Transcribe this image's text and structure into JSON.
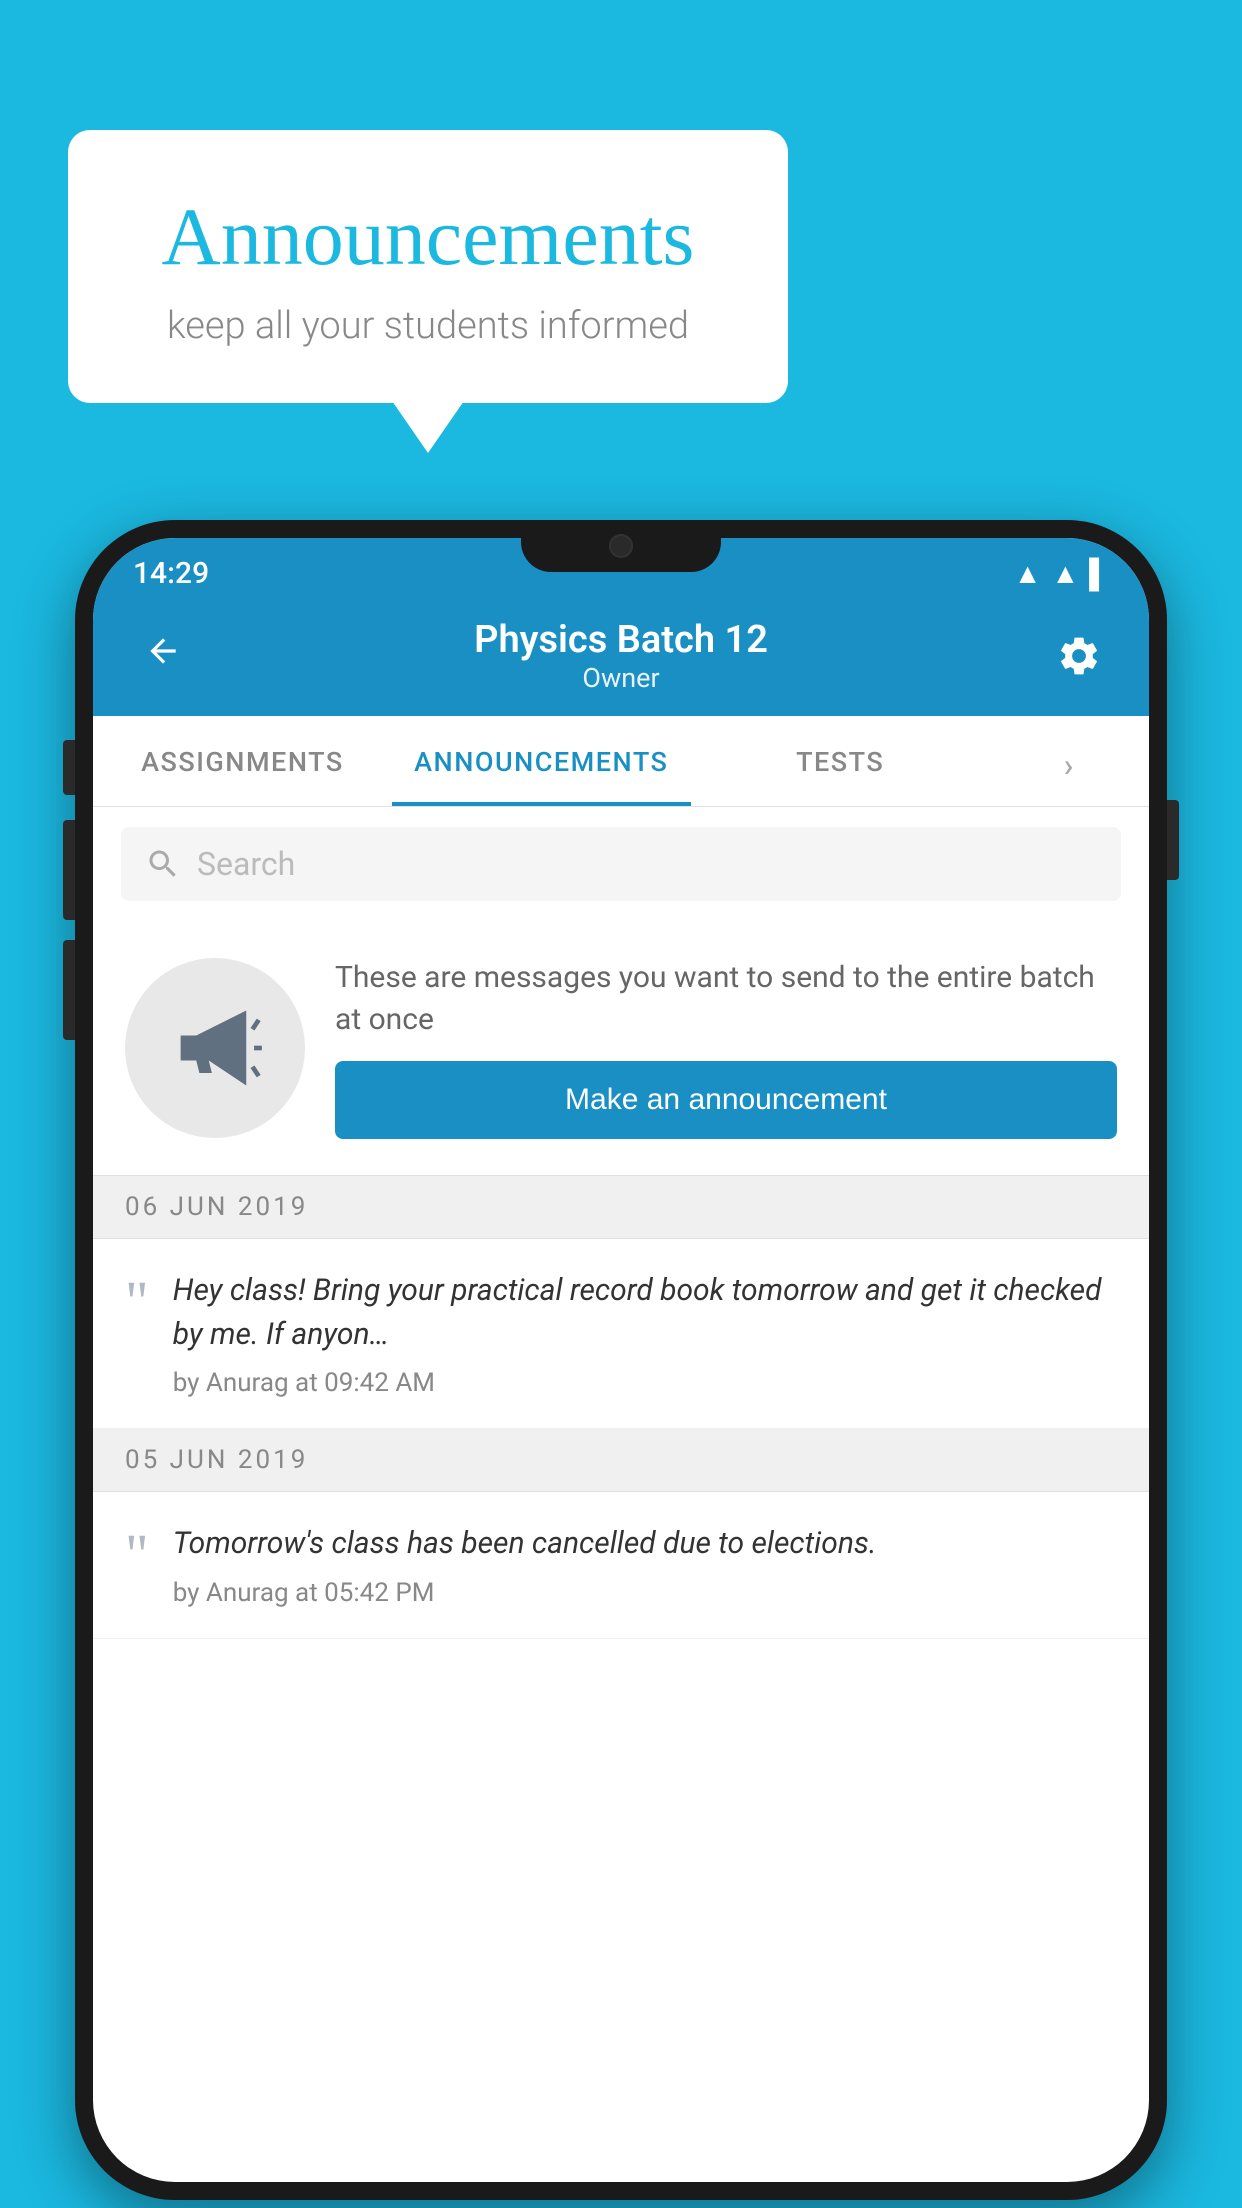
{
  "page": {
    "background_color": "#1bb8e0"
  },
  "speech_bubble": {
    "title": "Announcements",
    "subtitle": "keep all your students informed"
  },
  "phone": {
    "status_bar": {
      "time": "14:29",
      "wifi": "▲",
      "signal": "▲",
      "battery": "▌"
    },
    "header": {
      "title": "Physics Batch 12",
      "subtitle": "Owner",
      "back_label": "←"
    },
    "tabs": [
      {
        "label": "ASSIGNMENTS",
        "active": false
      },
      {
        "label": "ANNOUNCEMENTS",
        "active": true
      },
      {
        "label": "TESTS",
        "active": false
      },
      {
        "label": "›",
        "active": false
      }
    ],
    "search": {
      "placeholder": "Search"
    },
    "announcement_prompt": {
      "description": "These are messages you want to send to the entire batch at once",
      "button_label": "Make an announcement"
    },
    "date_groups": [
      {
        "date": "06  JUN  2019",
        "announcements": [
          {
            "text": "Hey class! Bring your practical record book tomorrow and get it checked by me. If anyon…",
            "meta": "by Anurag at 09:42 AM"
          }
        ]
      },
      {
        "date": "05  JUN  2019",
        "announcements": [
          {
            "text": "Tomorrow's class has been cancelled due to elections.",
            "meta": "by Anurag at 05:42 PM"
          }
        ]
      }
    ]
  }
}
